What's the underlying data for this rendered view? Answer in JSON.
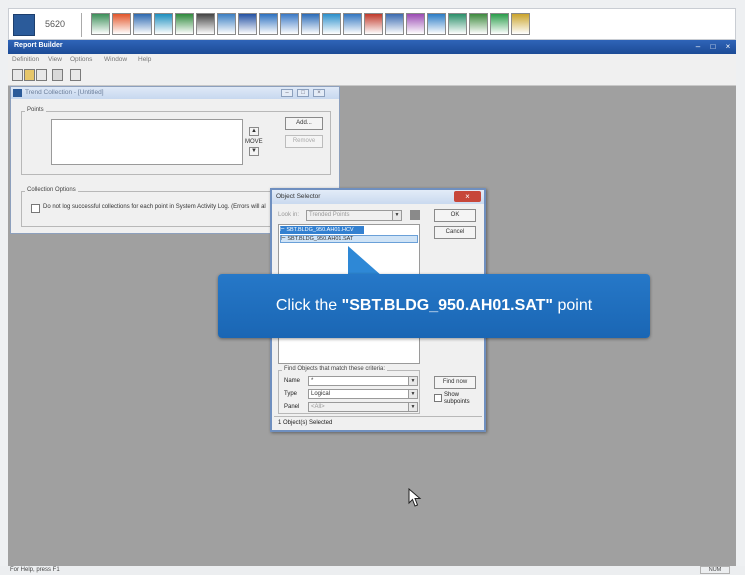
{
  "launcher": {
    "app_number": "5620",
    "icons": [
      "storage-icon",
      "warning-icon",
      "building-icon",
      "grid-icon",
      "trend-chart-icon",
      "gear-disc-icon",
      "monitor-icon",
      "controller-icon",
      "database-icon",
      "window-icon",
      "report-icon",
      "search-icon",
      "device-icon",
      "alarm-icon",
      "print-icon",
      "user-icon",
      "chart-icon",
      "network-icon",
      "trend-icon",
      "excel-icon",
      "signal-icon"
    ],
    "icon_colors": [
      "#3c8f59",
      "#e2552a",
      "#2d69b0",
      "#1d8fbf",
      "#2f8a3c",
      "#444444",
      "#3b7fc3",
      "#2451a3",
      "#2d71c0",
      "#3a79c6",
      "#2a6bb8",
      "#2b8fcb",
      "#3377c1",
      "#c0392b",
      "#3b6bb0",
      "#9a4ab3",
      "#2b7cc6",
      "#2b8f6a",
      "#3e8a3e",
      "#2a9d4a",
      "#caa32b"
    ]
  },
  "app_window": {
    "title": "Report Builder",
    "menu": [
      "Definition",
      "View",
      "Options",
      "Window",
      "Help"
    ],
    "toolbar_icons": [
      "new-icon",
      "open-icon",
      "save-icon",
      "print-icon",
      "help-icon"
    ]
  },
  "trend_window": {
    "title": "Trend Collection - [Untitled]",
    "points_label": "Points",
    "add_label": "Add...",
    "remove_label": "Remove",
    "move_label": "MOVE",
    "collection_options_label": "Collection Options",
    "checkbox_label": "Do not log successful collections for each point in System Activity Log. (Errors will al"
  },
  "object_selector": {
    "title": "Object Selector",
    "look_in_label": "Look in:",
    "look_in_value": "Trended Points",
    "ok_label": "OK",
    "cancel_label": "Cancel",
    "list_items": [
      "SBT.BLDG_950.AH01.HCV",
      "SBT.BLDG_950.AH01.SAT"
    ],
    "filter_label": "Find Objects that match these criteria:",
    "name_label": "Name",
    "name_value": "*",
    "type_label": "Type",
    "type_value": "Logical",
    "panel_label": "Panel",
    "panel_value": "<All>",
    "find_now_label": "Find now",
    "show_subpoints_label_1": "Show",
    "show_subpoints_label_2": "subpoints",
    "status": "1 Object(s) Selected"
  },
  "tooltip": {
    "prefix": "Click the ",
    "point": "\"SBT.BLDG_950.AH01.SAT\"",
    "suffix": " point",
    "color": "#2678c8"
  },
  "status_bar": {
    "text": "For Help, press F1",
    "num": "NUM"
  }
}
